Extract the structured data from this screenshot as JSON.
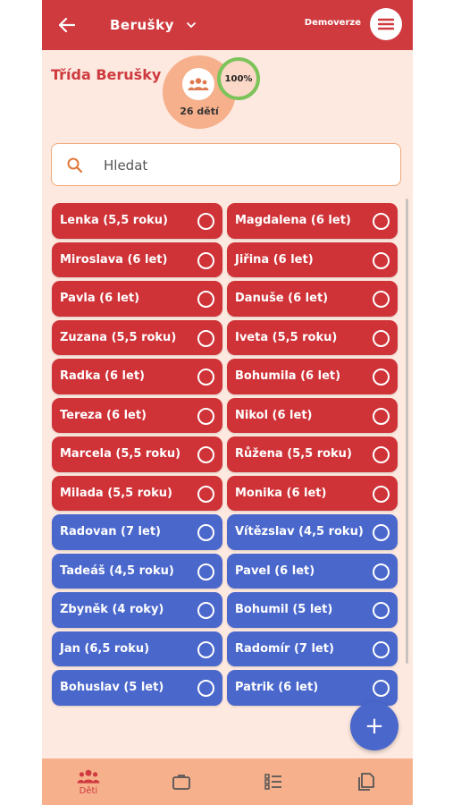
{
  "header": {
    "class_name": "Berušky",
    "demo_label": "Demoverze"
  },
  "class_info": {
    "title": "Třída Berušky",
    "children_count": "26 dětí",
    "attendance_percent": "100%"
  },
  "search": {
    "placeholder": "Hledat"
  },
  "children": [
    {
      "name": "Lenka (5,5 roku)",
      "gender": "girl"
    },
    {
      "name": "Magdalena (6 let)",
      "gender": "girl"
    },
    {
      "name": "Miroslava (6 let)",
      "gender": "girl"
    },
    {
      "name": "Jiřina (6 let)",
      "gender": "girl"
    },
    {
      "name": "Pavla (6 let)",
      "gender": "girl"
    },
    {
      "name": "Danuše (6 let)",
      "gender": "girl"
    },
    {
      "name": "Zuzana (5,5 roku)",
      "gender": "girl"
    },
    {
      "name": "Iveta (5,5 roku)",
      "gender": "girl"
    },
    {
      "name": "Radka (6 let)",
      "gender": "girl"
    },
    {
      "name": "Bohumila (6 let)",
      "gender": "girl"
    },
    {
      "name": "Tereza (6 let)",
      "gender": "girl"
    },
    {
      "name": "Nikol (6 let)",
      "gender": "girl"
    },
    {
      "name": "Marcela (5,5 roku)",
      "gender": "girl"
    },
    {
      "name": "Růžena (5,5 roku)",
      "gender": "girl"
    },
    {
      "name": "Milada (5,5 roku)",
      "gender": "girl"
    },
    {
      "name": "Monika (6 let)",
      "gender": "girl"
    },
    {
      "name": "Radovan (7 let)",
      "gender": "boy"
    },
    {
      "name": "Vítězslav (4,5 roku)",
      "gender": "boy"
    },
    {
      "name": "Tadeáš (4,5 roku)",
      "gender": "boy"
    },
    {
      "name": "Pavel (6 let)",
      "gender": "boy"
    },
    {
      "name": "Zbyněk (4 roky)",
      "gender": "boy"
    },
    {
      "name": "Bohumil (5 let)",
      "gender": "boy"
    },
    {
      "name": "Jan (6,5 roku)",
      "gender": "boy"
    },
    {
      "name": "Radomír (7 let)",
      "gender": "boy"
    },
    {
      "name": "Bohuslav (5 let)",
      "gender": "boy"
    },
    {
      "name": "Patrik (6 let)",
      "gender": "boy"
    }
  ],
  "fab": {
    "label": "+"
  },
  "bottom_nav": [
    {
      "icon": "people-icon",
      "label": "Děti",
      "active": true
    },
    {
      "icon": "briefcase-icon",
      "label": "",
      "active": false
    },
    {
      "icon": "checklist-icon",
      "label": "",
      "active": false
    },
    {
      "icon": "documents-icon",
      "label": "",
      "active": false
    }
  ],
  "colors": {
    "header": "#cf3a3f",
    "background": "#fde9e0",
    "girl": "#cf3237",
    "boy": "#4a67cc",
    "nav": "#f6b08c",
    "attendance_ring": "#7cc35a"
  }
}
